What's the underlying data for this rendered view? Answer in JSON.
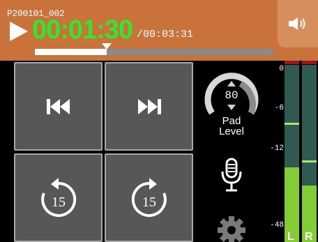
{
  "header": {
    "file_name": "P200101_002",
    "time_current": "00:01:30",
    "time_total": "/00:03:31",
    "progress_fraction": 0.3
  },
  "controls": {
    "rewind_icon": "skip-back-icon",
    "forward_icon": "skip-forward-icon",
    "back15_label": "15",
    "forward15_label": "15"
  },
  "pad": {
    "value": "80",
    "label_line1": "Pad",
    "label_line2": "Level"
  },
  "meters": {
    "scale": [
      "0",
      "-6",
      "-12",
      "-48"
    ],
    "left": {
      "label": "L",
      "level": 0.42,
      "peak": 0.66
    },
    "right": {
      "label": "R",
      "level": 0.32,
      "peak": 0.45
    }
  },
  "colors": {
    "header_bg": "#c9733a",
    "time_green": "#2ee82e",
    "meter_green": "#82cc34",
    "meter_bg": "#2f5a52"
  }
}
